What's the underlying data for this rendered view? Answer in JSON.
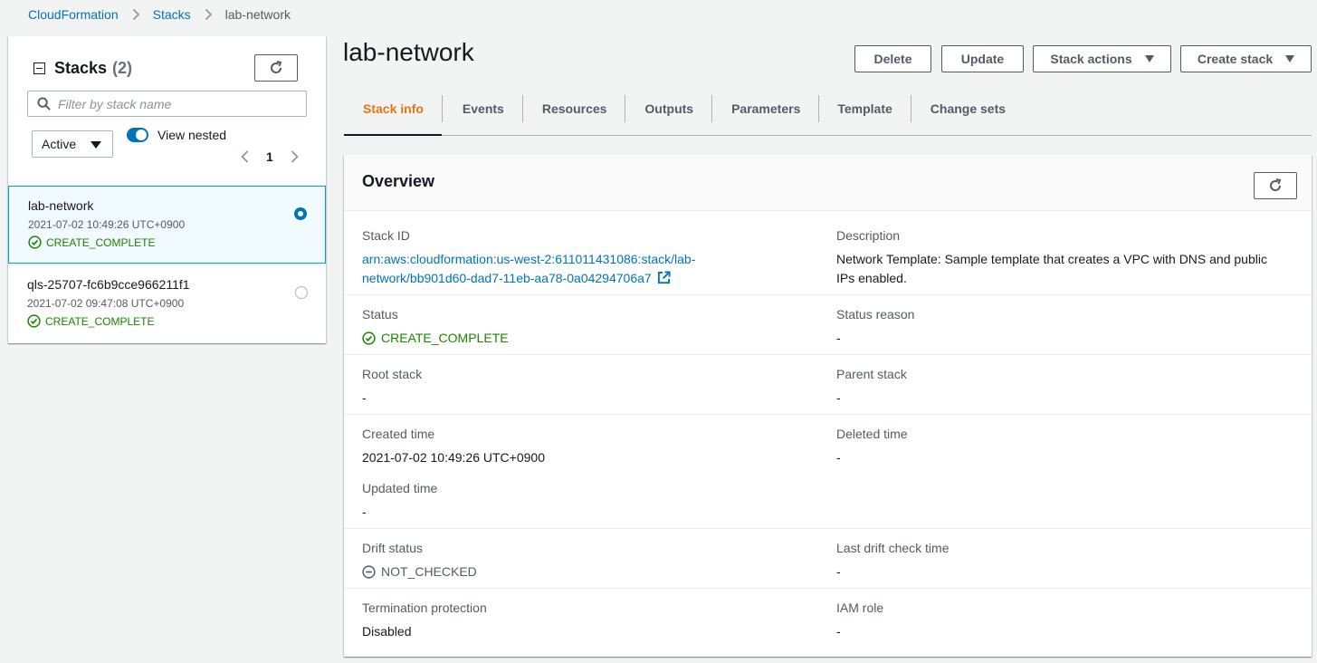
{
  "breadcrumb": {
    "items": [
      "CloudFormation",
      "Stacks"
    ],
    "current": "lab-network"
  },
  "left_panel": {
    "title": "Stacks",
    "count": "(2)",
    "filter_placeholder": "Filter by stack name",
    "filter_select": "Active",
    "view_nested_label": "View nested",
    "view_nested_on": true,
    "page": "1",
    "stacks": [
      {
        "name": "lab-network",
        "time": "2021-07-02 10:49:26 UTC+0900",
        "status": "CREATE_COMPLETE",
        "selected": true
      },
      {
        "name": "qls-25707-fc6b9cce966211f1",
        "time": "2021-07-02 09:47:08 UTC+0900",
        "status": "CREATE_COMPLETE",
        "selected": false
      }
    ]
  },
  "header": {
    "title": "lab-network",
    "buttons": {
      "delete": "Delete",
      "update": "Update",
      "stack_actions": "Stack actions",
      "create_stack": "Create stack"
    }
  },
  "tabs": [
    "Stack info",
    "Events",
    "Resources",
    "Outputs",
    "Parameters",
    "Template",
    "Change sets"
  ],
  "active_tab": "Stack info",
  "overview": {
    "title": "Overview",
    "stack_id_label": "Stack ID",
    "stack_id_line1": "arn:aws:cloudformation:us-west-2:611011431086:stack/lab-",
    "stack_id_line2": "network/bb901d60-dad7-11eb-aa78-0a04294706a7",
    "description_label": "Description",
    "description_line1": "Network Template: Sample template that creates a VPC with DNS and public",
    "description_line2": "IPs enabled.",
    "status_label": "Status",
    "status_value": "CREATE_COMPLETE",
    "status_reason_label": "Status reason",
    "status_reason_value": "-",
    "root_stack_label": "Root stack",
    "root_stack_value": "-",
    "parent_stack_label": "Parent stack",
    "parent_stack_value": "-",
    "created_time_label": "Created time",
    "created_time_value": "2021-07-02 10:49:26 UTC+0900",
    "deleted_time_label": "Deleted time",
    "deleted_time_value": "-",
    "updated_time_label": "Updated time",
    "updated_time_value": "-",
    "drift_status_label": "Drift status",
    "drift_status_value": "NOT_CHECKED",
    "last_drift_label": "Last drift check time",
    "last_drift_value": "-",
    "termination_label": "Termination protection",
    "termination_value": "Disabled",
    "iam_role_label": "IAM role",
    "iam_role_value": "-"
  },
  "colors": {
    "link": "#0073bb",
    "success": "#1d8102",
    "active_tab": "#ec7211",
    "background": "#f2f3f3"
  }
}
